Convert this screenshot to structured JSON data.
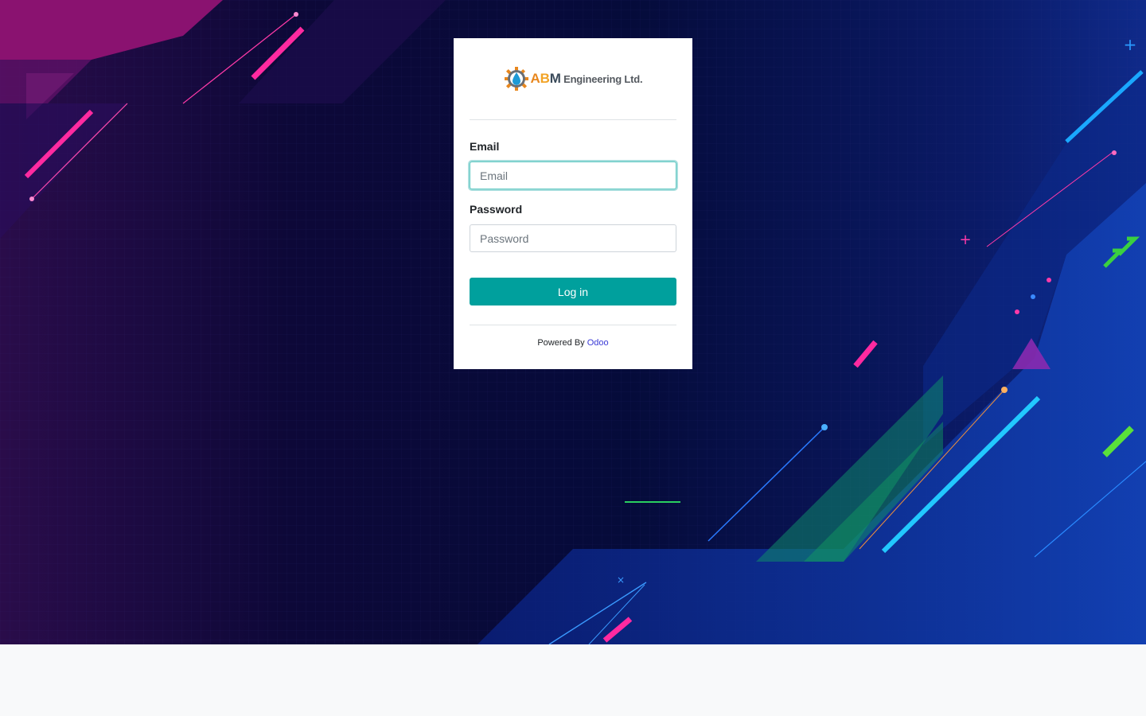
{
  "brand": {
    "letters": [
      "A",
      "B",
      "M"
    ],
    "name": "Engineering Ltd."
  },
  "form": {
    "email_label": "Email",
    "email_placeholder": "Email",
    "email_value": "",
    "password_label": "Password",
    "password_placeholder": "Password",
    "password_value": "",
    "login_label": "Log in"
  },
  "footer": {
    "powered_by": "Powered By",
    "link_text": "Odoo"
  },
  "colors": {
    "primary": "#00a09d",
    "link": "#3a3ad6",
    "page_bg": "#f8f9fa"
  }
}
